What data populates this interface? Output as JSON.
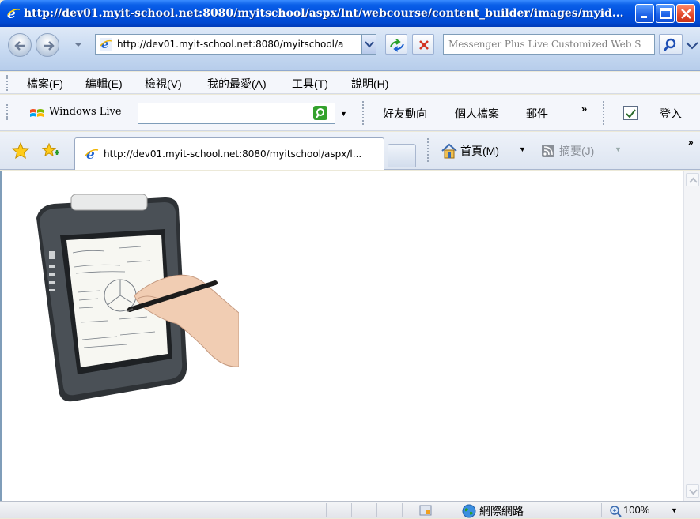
{
  "window": {
    "title": "http://dev01.myit-school.net:8080/myitschool/aspx/lnt/webcourse/content_builder/images/myid..."
  },
  "address_bar": {
    "url": "http://dev01.myit-school.net:8080/myitschool/a"
  },
  "search": {
    "placeholder": "Messenger Plus Live Customized Web S"
  },
  "menu": {
    "items": [
      "檔案(F)",
      "編輯(E)",
      "檢視(V)",
      "我的最愛(A)",
      "工具(T)",
      "說明(H)"
    ]
  },
  "windows_live": {
    "label": "Windows Live",
    "links": [
      "好友動向",
      "個人檔案",
      "郵件"
    ],
    "chevron": "»",
    "signin": "登入"
  },
  "tabs": {
    "active_title": "http://dev01.myit-school.net:8080/myitschool/aspx/l..."
  },
  "command_bar": {
    "home": "首頁(M)",
    "feeds": "摘要(J)",
    "chevron": "»"
  },
  "status_bar": {
    "zone": "網際網路",
    "zoom": "100%"
  },
  "colors": {
    "title_bar": "#0050e0",
    "close_button": "#e2492a",
    "search_green": "#33a12c"
  },
  "icons": [
    "ie-logo-icon",
    "back-arrow-icon",
    "forward-arrow-icon",
    "go-icon",
    "stop-icon",
    "search-icon",
    "windows-live-logo-icon",
    "favorites-star-icon",
    "add-favorites-icon",
    "home-icon",
    "feed-icon",
    "globe-icon",
    "zoom-icon",
    "lock-icon"
  ]
}
